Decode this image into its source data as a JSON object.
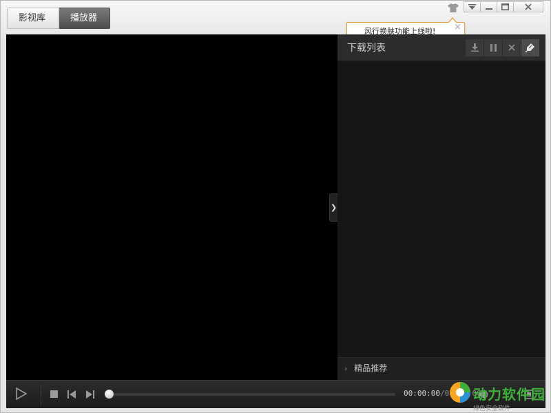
{
  "tabs": [
    {
      "label": "影视库",
      "active": false
    },
    {
      "label": "播放器",
      "active": true
    }
  ],
  "titlebar": {
    "icons": [
      "skin-icon",
      "dropdown-icon",
      "minimize-icon",
      "maximize-icon",
      "close-icon"
    ]
  },
  "tooltip": {
    "text": "风行换肤功能上线啦!",
    "close": "×",
    "border_color": "#f09c3c"
  },
  "panel": {
    "title": "下载列表",
    "tools": [
      "download-icon",
      "pause-icon",
      "delete-icon",
      "clean-icon"
    ],
    "recommend_chevron": "›",
    "recommend_label": "精品推荐",
    "collapse_glyph": "❯"
  },
  "controls": {
    "icons": [
      "play-icon",
      "stop-icon",
      "previous-icon",
      "next-icon",
      "volume-icon",
      "fullscreen-icon"
    ],
    "progress": 0,
    "time_current": "00:00:00",
    "time_separator": "/",
    "time_total": "00:00:00"
  },
  "watermark": {
    "brand": "动力软件园",
    "slogan": "绿色安全软件",
    "brand_color": "#3fae3a"
  }
}
